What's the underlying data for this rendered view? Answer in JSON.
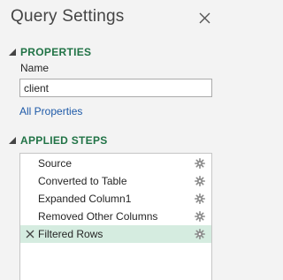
{
  "pane": {
    "title": "Query Settings",
    "close_icon": "close-icon"
  },
  "properties": {
    "header": "PROPERTIES",
    "name_label": "Name",
    "name_value": "client",
    "all_properties_link": "All Properties"
  },
  "applied_steps": {
    "header": "APPLIED STEPS",
    "steps": [
      {
        "label": "Source",
        "icon": "gear-icon"
      },
      {
        "label": "Converted to Table",
        "icon": "gear-icon"
      },
      {
        "label": "Expanded Column1",
        "icon": "gear-icon"
      },
      {
        "label": "Removed Other Columns",
        "icon": "gear-icon"
      },
      {
        "label": "Filtered Rows",
        "icon": "gear-icon",
        "selected": true,
        "delete_icon": "delete-step-icon"
      }
    ]
  },
  "colors": {
    "accent": "#217346",
    "link": "#1e5aa8",
    "selected_row": "#d5ece0",
    "pane_bg": "#f3f3f3"
  }
}
